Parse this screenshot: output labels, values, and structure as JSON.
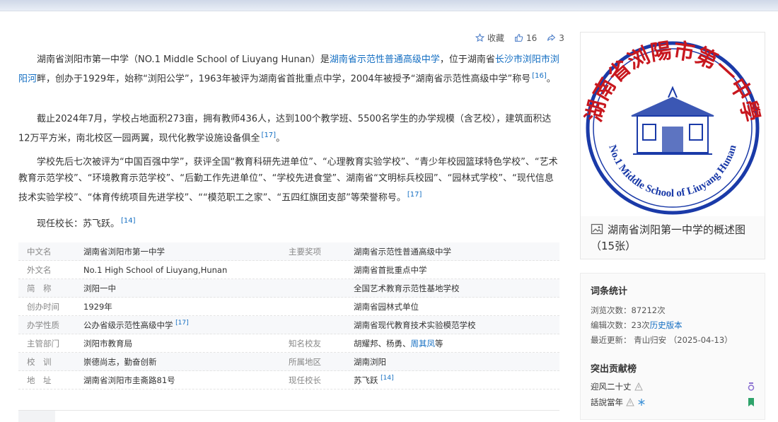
{
  "actions": {
    "favorite": "收藏",
    "likes": "16",
    "shares": "3"
  },
  "paragraphs": {
    "p1": {
      "a": "湖南省浏阳市第一中学（NO.1 Middle School of Liuyang Hunan）是",
      "link1": "湖南省示范性普通高级中学",
      "b": "，位于湖南省",
      "link2": "长沙市浏阳市",
      "link3": "浏阳河",
      "c": "畔，创办于1929年，始称“浏阳公学”，1963年被评为湖南省首批重点中学，2004年被授予“湖南省示范性高级中学”称号",
      "ref": "[16]",
      "end": "。"
    },
    "p2": {
      "text": "截止2024年7月，学校占地面积273亩，拥有教师436人，达到100个教学班、5500名学生的办学规模（含艺校），建筑面积达12万平方米，南北校区一园两翼，现代化教学设施设备俱全",
      "ref": "[17]",
      "end": "。"
    },
    "p3": {
      "text": "学校先后七次被评为“中国百强中学”，获评全国“教育科研先进单位”、“心理教育实验学校”、“青少年校园篮球特色学校”、“艺术教育示范学校”、“环境教育示范学校”、“后勤工作先进单位”、“学校先进食堂”、湖南省“文明标兵校园”、“园林式学校”、“现代信息技术实验学校”、“体育传统项目先进学校”、““模范职工之家”、“五四红旗团支部”等荣誉称号。",
      "ref": "[17]"
    },
    "p4": {
      "text": "现任校长：苏飞跃。",
      "ref": "[14]"
    }
  },
  "infobox": {
    "rows": [
      {
        "k": "中文名",
        "v": "湖南省浏阳市第一中学",
        "k2": "主要奖项",
        "v2": "湖南省示范性普通高级中学"
      },
      {
        "k": "外文名",
        "v": "No.1 High School of Liuyang,Hunan",
        "k2": "",
        "v2": "湖南省首批重点中学"
      },
      {
        "k": "简　称",
        "v": "浏阳一中",
        "k2": "",
        "v2": "全国艺术教育示范性基地学校"
      },
      {
        "k": "创办时间",
        "v": "1929年",
        "k2": "",
        "v2": "湖南省园林式单位"
      },
      {
        "k": "办学性质",
        "v": "公办省级示范性高级中学",
        "ref": "[17]",
        "k2": "",
        "v2": "湖南省现代教育技术实验模范学校"
      },
      {
        "k": "主管部门",
        "v": "浏阳市教育局",
        "k2": "知名校友",
        "v2a": "胡耀邦、杨勇、",
        "v2link": "周其凤",
        "v2b": "等"
      },
      {
        "k": "校　训",
        "v": "崇德尚志，勤奋创新",
        "k2": "所属地区",
        "v2": "湖南浏阳"
      },
      {
        "k": "地　址",
        "v": "湖南省浏阳市圭斋路81号",
        "k2": "现任校长",
        "v2": "苏飞跃",
        "ref2": "[14]"
      }
    ]
  },
  "logo": {
    "top_text": "湖南省浏陽市第一中學",
    "bottom_text": "No.1 Middle School of Liuyang Hunan",
    "color": "#1a3aa8"
  },
  "image_caption": {
    "text": "湖南省浏阳第一中学的概述图",
    "count": "（15张）"
  },
  "stats": {
    "title": "词条统计",
    "views": "浏览次数：87212次",
    "edits_a": "编辑次数：23次",
    "edits_link": "历史版本",
    "updated": "最近更新：  青山归安  （2025-04-13）",
    "contrib_title": "突出贡献榜",
    "contributors": [
      "迎风二十丈",
      "話說當年"
    ]
  }
}
